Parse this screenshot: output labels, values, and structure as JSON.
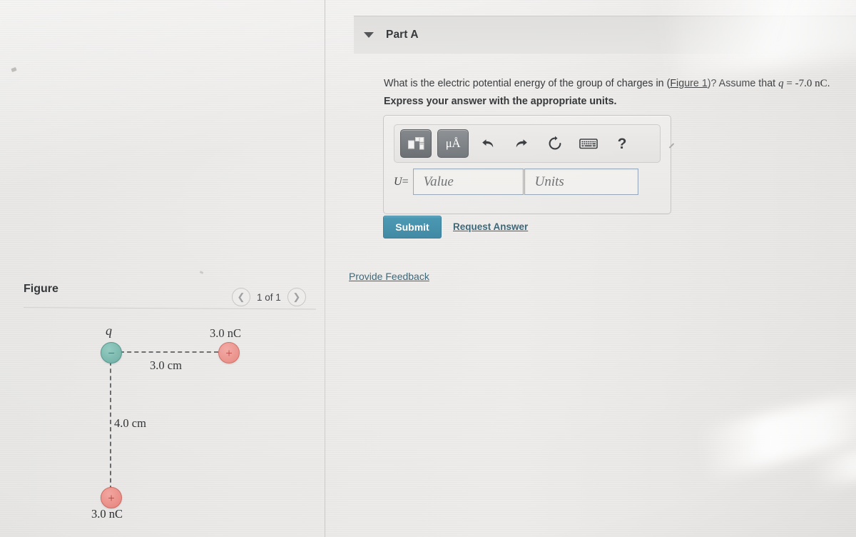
{
  "question_panel": {
    "part_header": {
      "label": "Part A",
      "caret_icon": "triangle-down-icon"
    },
    "question_prefix": "What is the electric potential energy of the group of charges in (",
    "figure_link_text": "Figure 1",
    "question_middle": ")? Assume that ",
    "question_var": "q",
    "question_eq": " = -7.0 ",
    "question_unit": "nC",
    "question_suffix": ".",
    "instruction": "Express your answer with the appropriate units.",
    "toolbar": {
      "template_button": "template-icon",
      "units_button_label": "μÅ",
      "undo_icon": "undo-arrow-icon",
      "redo_icon": "redo-arrow-icon",
      "reset_icon": "reset-circular-arrow-icon",
      "keyboard_icon": "keyboard-icon",
      "help_label": "?",
      "resize_handle": "resize-handle-icon"
    },
    "answer": {
      "variable_label": "U",
      "equals": "=",
      "value_placeholder": "Value",
      "value": "",
      "units_placeholder": "Units",
      "units": ""
    },
    "submit_label": "Submit",
    "request_answer_label": "Request Answer",
    "provide_feedback_label": "Provide Feedback",
    "accent_color": "#2f7e9b",
    "link_color": "#2b5b6e"
  },
  "figure_panel": {
    "title": "Figure",
    "nav": {
      "prev_icon": "chevron-left-icon",
      "next_icon": "chevron-right-icon",
      "counter": "1 of 1"
    },
    "diagram": {
      "charges": [
        {
          "id": "top-left",
          "sign": "−",
          "label": "q",
          "type": "negative",
          "color": "#74b3a8"
        },
        {
          "id": "top-right",
          "sign": "+",
          "label": "3.0 nC",
          "type": "positive",
          "color": "#e98d86"
        },
        {
          "id": "bottom-left",
          "sign": "+",
          "label": "3.0 nC",
          "type": "positive",
          "color": "#e98d86"
        }
      ],
      "distances": [
        {
          "id": "horizontal",
          "label": "3.0 cm"
        },
        {
          "id": "vertical",
          "label": "4.0 cm"
        }
      ]
    }
  }
}
